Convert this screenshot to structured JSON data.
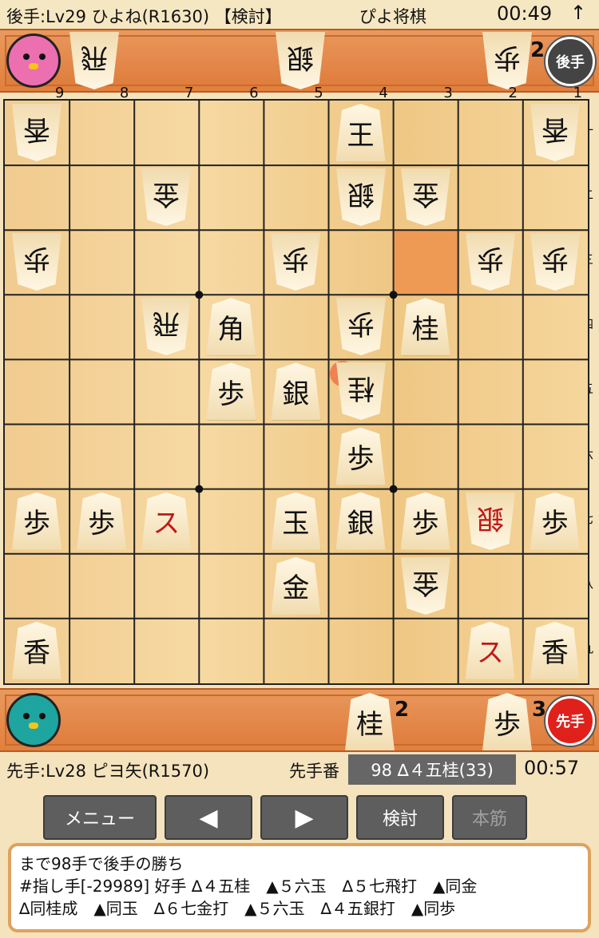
{
  "top": {
    "player_info": "後手:Lv29 ひよね(R1630) 【検討】",
    "title": "ぴよ将棋",
    "time": "00:49",
    "arrow": "↑"
  },
  "gote_hand": {
    "pieces": [
      {
        "label": "飛",
        "count": ""
      },
      {
        "label": "銀",
        "count": ""
      },
      {
        "label": "歩",
        "count": "2"
      }
    ],
    "badge": "後手"
  },
  "sente_hand": {
    "pieces": [
      {
        "label": "桂",
        "count": "2"
      },
      {
        "label": "歩",
        "count": "3"
      }
    ],
    "badge": "先手"
  },
  "file_labels": [
    "9",
    "8",
    "7",
    "6",
    "5",
    "4",
    "3",
    "2",
    "1"
  ],
  "rank_labels": [
    "一",
    "二",
    "三",
    "四",
    "五",
    "六",
    "七",
    "八",
    "九"
  ],
  "board": [
    {
      "file": 9,
      "rank": 1,
      "label": "香",
      "owner": "gote"
    },
    {
      "file": 4,
      "rank": 1,
      "label": "王",
      "owner": "sente_upright"
    },
    {
      "file": 1,
      "rank": 1,
      "label": "香",
      "owner": "gote"
    },
    {
      "file": 7,
      "rank": 2,
      "label": "金",
      "owner": "gote"
    },
    {
      "file": 4,
      "rank": 2,
      "label": "銀",
      "owner": "gote"
    },
    {
      "file": 3,
      "rank": 2,
      "label": "金",
      "owner": "gote"
    },
    {
      "file": 9,
      "rank": 3,
      "label": "歩",
      "owner": "gote"
    },
    {
      "file": 5,
      "rank": 3,
      "label": "歩",
      "owner": "gote"
    },
    {
      "file": 2,
      "rank": 3,
      "label": "歩",
      "owner": "gote"
    },
    {
      "file": 1,
      "rank": 3,
      "label": "歩",
      "owner": "gote"
    },
    {
      "file": 7,
      "rank": 4,
      "label": "飛",
      "owner": "gote"
    },
    {
      "file": 6,
      "rank": 4,
      "label": "角",
      "owner": "sente"
    },
    {
      "file": 4,
      "rank": 4,
      "label": "歩",
      "owner": "gote"
    },
    {
      "file": 3,
      "rank": 4,
      "label": "桂",
      "owner": "sente"
    },
    {
      "file": 6,
      "rank": 5,
      "label": "歩",
      "owner": "sente"
    },
    {
      "file": 5,
      "rank": 5,
      "label": "銀",
      "owner": "sente"
    },
    {
      "file": 4,
      "rank": 5,
      "label": "桂",
      "owner": "gote"
    },
    {
      "file": 4,
      "rank": 6,
      "label": "歩",
      "owner": "sente"
    },
    {
      "file": 9,
      "rank": 7,
      "label": "歩",
      "owner": "sente"
    },
    {
      "file": 8,
      "rank": 7,
      "label": "歩",
      "owner": "sente"
    },
    {
      "file": 7,
      "rank": 7,
      "label": "ス",
      "owner": "sente",
      "promoted": true
    },
    {
      "file": 5,
      "rank": 7,
      "label": "玉",
      "owner": "sente"
    },
    {
      "file": 4,
      "rank": 7,
      "label": "銀",
      "owner": "sente"
    },
    {
      "file": 3,
      "rank": 7,
      "label": "歩",
      "owner": "sente"
    },
    {
      "file": 2,
      "rank": 7,
      "label": "銀",
      "owner": "gote",
      "promoted": true
    },
    {
      "file": 1,
      "rank": 7,
      "label": "歩",
      "owner": "sente"
    },
    {
      "file": 5,
      "rank": 8,
      "label": "金",
      "owner": "sente"
    },
    {
      "file": 3,
      "rank": 8,
      "label": "金",
      "owner": "gote"
    },
    {
      "file": 9,
      "rank": 9,
      "label": "香",
      "owner": "sente"
    },
    {
      "file": 2,
      "rank": 9,
      "label": "ス",
      "owner": "sente",
      "promoted": true
    },
    {
      "file": 1,
      "rank": 9,
      "label": "香",
      "owner": "sente"
    }
  ],
  "highlight": {
    "file": 3,
    "rank": 3
  },
  "info": {
    "sente_player": "先手:Lv28 ピヨ矢(R1570)",
    "turn": "先手番",
    "last_move": "98 ∆４五桂(33)",
    "time": "00:57"
  },
  "buttons": {
    "menu": "メニュー",
    "prev": "◀",
    "next": "▶",
    "review": "検討",
    "mainline": "本筋"
  },
  "comment": {
    "line1": "まで98手で後手の勝ち",
    "line2": "#指し手[-29989] 好手 ∆４五桂　▲５六玉　∆５七飛打　▲同金",
    "line3": "∆同桂成　▲同玉　∆６七金打　▲５六玉　∆４五銀打　▲同歩"
  }
}
